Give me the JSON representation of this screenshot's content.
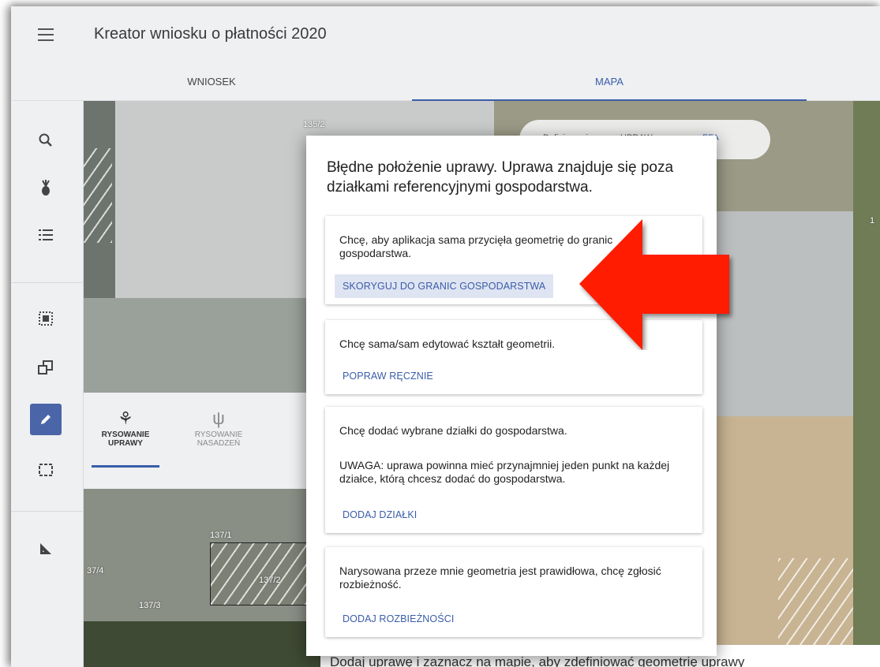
{
  "header": {
    "title": "Kreator wniosku o płatności 2020"
  },
  "tabs": [
    {
      "label": "WNIOSEK"
    },
    {
      "label": "MAPA"
    }
  ],
  "sidebar": {
    "icons": [
      "search-icon",
      "plant-icon",
      "list-icon",
      "select-area-icon",
      "copy-shape-icon",
      "pencil-icon",
      "dashed-rect-icon",
      "measure-angle-icon"
    ],
    "active": "pencil-icon"
  },
  "map": {
    "labels": [
      "135/2",
      "137/1",
      "37/4",
      "137/2",
      "137/3",
      "1"
    ],
    "toggle": {
      "left": "Definiowanie",
      "middle": "UPRAW",
      "right": "EFA"
    }
  },
  "draw_panel": {
    "items": [
      {
        "line1": "RYSOWANIE",
        "line2": "UPRAWY"
      },
      {
        "line1": "RYSOWANIE",
        "line2": "NASADZEŃ"
      }
    ]
  },
  "bottom_text": "Dodaj uprawę i zaznacz na mapie, aby zdefiniować geometrię uprawy",
  "modal": {
    "title": "Błędne położenie uprawy. Uprawa znajduje się poza działkami referencyjnymi gospodarstwa.",
    "cards": [
      {
        "text": "Chcę, aby aplikacja sama przycięła geometrię do granic gospodarstwa.",
        "button": "SKORYGUJ DO GRANIC GOSPODARSTWA"
      },
      {
        "text": "Chcę sama/sam edytować kształt geometrii.",
        "button": "POPRAW RĘCZNIE"
      },
      {
        "text": "Chcę dodać wybrane działki do gospodarstwa.",
        "note": "UWAGA: uprawa powinna mieć przynajmniej jeden punkt na każdej działce, którą chcesz dodać do gospodarstwa.",
        "button": "DODAJ DZIAŁKI"
      },
      {
        "text": "Narysowana przeze mnie geometria jest prawidłowa, chcę zgłosić rozbieżność.",
        "button": "DODAJ ROZBIEŻNOŚCI"
      }
    ]
  },
  "colors": {
    "accent": "#3a5da8",
    "arrow": "#ff1a00",
    "active_button": "#4a65a8"
  }
}
